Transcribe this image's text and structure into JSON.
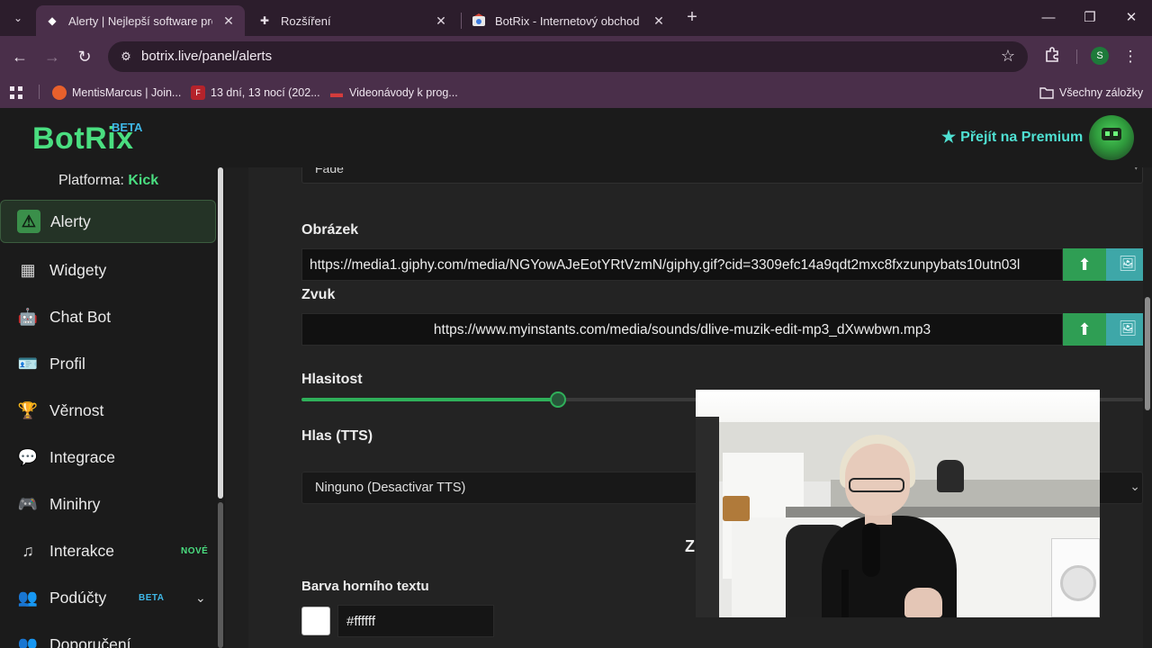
{
  "browser": {
    "tabs": [
      {
        "title": "Alerty | Nejlepší software pro vy",
        "icon": "botrix-favicon",
        "active": true
      },
      {
        "title": "Rozšíření",
        "icon": "puzzle-icon",
        "active": false
      },
      {
        "title": "BotRix - Internetový obchod Ch",
        "icon": "webstore-favicon",
        "active": false
      }
    ],
    "tab_close": "✕",
    "new_tab": "+",
    "window_controls": {
      "minimize": "—",
      "maximize": "❐",
      "close": "✕"
    },
    "nav": {
      "back": "←",
      "forward": "→",
      "reload": "↻"
    },
    "url": "botrix.live/panel/alerts",
    "site_icon": "⚙",
    "bookmark_star": "☆",
    "extensions_icon": "puzzle-icon",
    "profile_initial": "S",
    "menu_dots": "⋮",
    "bookmarks": [
      {
        "label": "MentisMarcus | Join...",
        "icon": "kick-favicon"
      },
      {
        "label": "13 dní, 13 nocí (202...",
        "icon": "film-favicon"
      },
      {
        "label": "Videonávody k prog...",
        "icon": "video-favicon"
      }
    ],
    "all_bookmarks": "Všechny záložky"
  },
  "header": {
    "logo": "BotRix",
    "logo_badge": "BETA",
    "premium_label": "Přejít na Premium",
    "premium_icon": "★"
  },
  "sidebar": {
    "platform_label": "Platforma:",
    "platform_value": "Kick",
    "items": [
      {
        "label": "Alerty",
        "icon": "⚠",
        "active": true
      },
      {
        "label": "Widgety",
        "icon": "▦"
      },
      {
        "label": "Chat Bot",
        "icon": "🤖"
      },
      {
        "label": "Profil",
        "icon": "🪪"
      },
      {
        "label": "Věrnost",
        "icon": "🏆"
      },
      {
        "label": "Integrace",
        "icon": "💬"
      },
      {
        "label": "Minihry",
        "icon": "🎮"
      },
      {
        "label": "Interakce",
        "icon": "♫",
        "badge": "NOVÉ"
      },
      {
        "label": "Podúčty",
        "icon": "👥",
        "badge": "BETA",
        "chevron": "⌄"
      },
      {
        "label": "Doporučení",
        "icon": "👥"
      }
    ]
  },
  "form": {
    "animation_select": "Fade",
    "image_label": "Obrázek",
    "image_url": "https://media1.giphy.com/media/NGYowAJeEotYRtVzmN/giphy.gif?cid=3309efc14a9qdt2mxc8fxzunpybats10utn03l",
    "sound_label": "Zvuk",
    "sound_url": "https://www.myinstants.com/media/sounds/dlive-muzik-edit-mp3_dXwwbwn.mp3",
    "upload_icon": "⬆",
    "gallery_icon": "🖼",
    "volume_label": "Hlasitost",
    "volume_value": 0.305,
    "tts_label": "Hlas (TTS)",
    "tts_value": "Ninguno (Desactivar TTS)",
    "tts_chevron": "⌄",
    "clipped_heading": "Z",
    "top_text_color_label": "Barva horního textu",
    "top_text_color": "#ffffff"
  },
  "colors": {
    "brand_green": "#4ade80",
    "premium_teal": "#4fe0d2",
    "upload_green": "#2f9e54",
    "gallery_teal": "#3ea7a8",
    "chrome_purple": "#4a2f4a"
  }
}
